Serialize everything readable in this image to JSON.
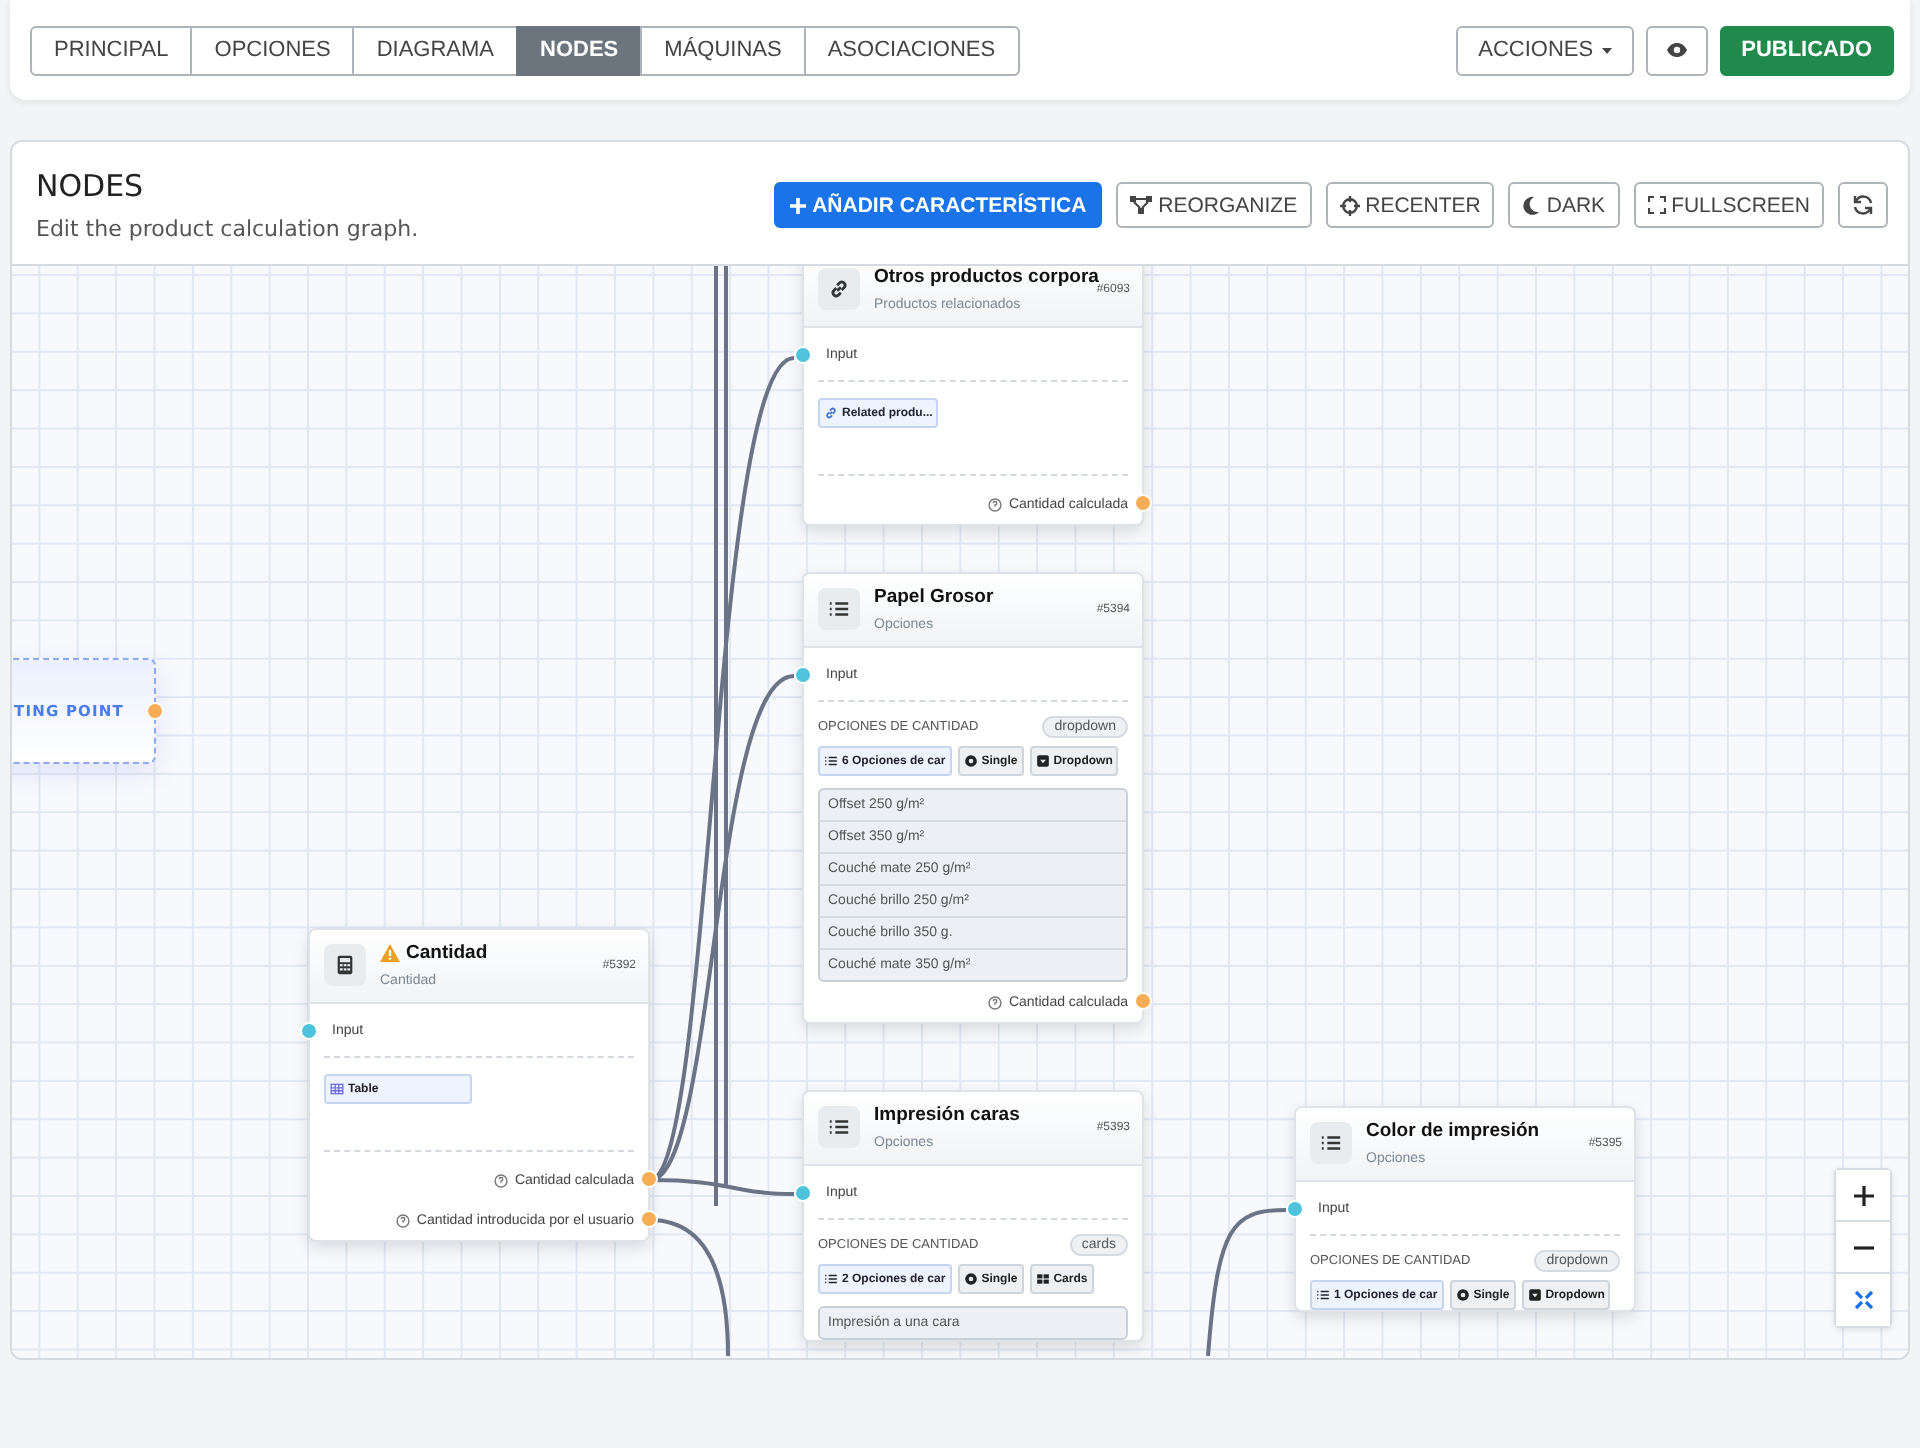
{
  "toolbar": {
    "tabs": [
      {
        "label": "PRINCIPAL",
        "selected": false
      },
      {
        "label": "OPCIONES",
        "selected": false
      },
      {
        "label": "DIAGRAMA",
        "selected": false
      },
      {
        "label": "NODES",
        "selected": true
      },
      {
        "label": "MÁQUINAS",
        "selected": false
      },
      {
        "label": "ASOCIACIONES",
        "selected": false
      }
    ],
    "actions_button": "ACCIONES",
    "publish_button": "PUBLICADO"
  },
  "panel": {
    "title": "NODES",
    "subtitle": "Edit the product calculation graph.",
    "buttons": [
      {
        "kind": "add",
        "label": "AÑADIR CARACTERÍSTICA"
      },
      {
        "kind": "reorganize",
        "label": "REORGANIZE"
      },
      {
        "kind": "recenter",
        "label": "RECENTER"
      },
      {
        "kind": "dark",
        "label": "DARK"
      },
      {
        "kind": "fullscreen",
        "label": "FULLSCREEN"
      },
      {
        "kind": "refresh"
      }
    ]
  },
  "graph": {
    "start_node": {
      "label": "TING POINT"
    },
    "nodes": [
      {
        "title": "Otros productos corpora",
        "subtitle": "Productos relacionados",
        "id": "#6093",
        "warning": false,
        "inputs": [
          "Input"
        ],
        "chips": [
          {
            "kind": "link",
            "label": "Related produ..."
          }
        ],
        "outputs": [
          "Cantidad calculada"
        ]
      },
      {
        "title": "Papel Grosor",
        "subtitle": "Opciones",
        "id": "#5394",
        "warning": false,
        "inputs": [
          "Input"
        ],
        "section_label": "OPCIONES DE CANTIDAD",
        "badge": "dropdown",
        "chips": [
          {
            "kind": "list",
            "label": "6 Opciones de car"
          },
          {
            "kind": "single",
            "label": "Single"
          },
          {
            "kind": "dropdown",
            "label": "Dropdown"
          }
        ],
        "options": [
          "Offset 250 g/m²",
          "Offset 350 g/m²",
          "Couché mate 250 g/m²",
          "Couché brillo 250 g/m²",
          "Couché brillo 350 g.",
          "Couché mate 350 g/m²"
        ],
        "outputs": [
          "Cantidad calculada"
        ]
      },
      {
        "title": "Cantidad",
        "subtitle": "Cantidad",
        "id": "#5392",
        "warning": true,
        "inputs": [
          "Input"
        ],
        "chips": [
          {
            "kind": "table",
            "label": "Table"
          }
        ],
        "outputs": [
          "Cantidad calculada",
          "Cantidad introducida por el usuario"
        ]
      },
      {
        "title": "Impresión caras",
        "subtitle": "Opciones",
        "id": "#5393",
        "warning": false,
        "inputs": [
          "Input"
        ],
        "section_label": "OPCIONES DE CANTIDAD",
        "badge": "cards",
        "chips": [
          {
            "kind": "list",
            "label": "2 Opciones de car"
          },
          {
            "kind": "single",
            "label": "Single"
          },
          {
            "kind": "cards",
            "label": "Cards"
          }
        ],
        "options": [
          "Impresión a una cara"
        ]
      },
      {
        "title": "Color de impresión",
        "subtitle": "Opciones",
        "id": "#5395",
        "warning": false,
        "inputs": [
          "Input"
        ],
        "section_label": "OPCIONES DE CANTIDAD",
        "badge": "dropdown",
        "chips": [
          {
            "kind": "list",
            "label": "1 Opciones de car"
          },
          {
            "kind": "single",
            "label": "Single"
          },
          {
            "kind": "dropdown",
            "label": "Dropdown"
          }
        ]
      }
    ]
  }
}
